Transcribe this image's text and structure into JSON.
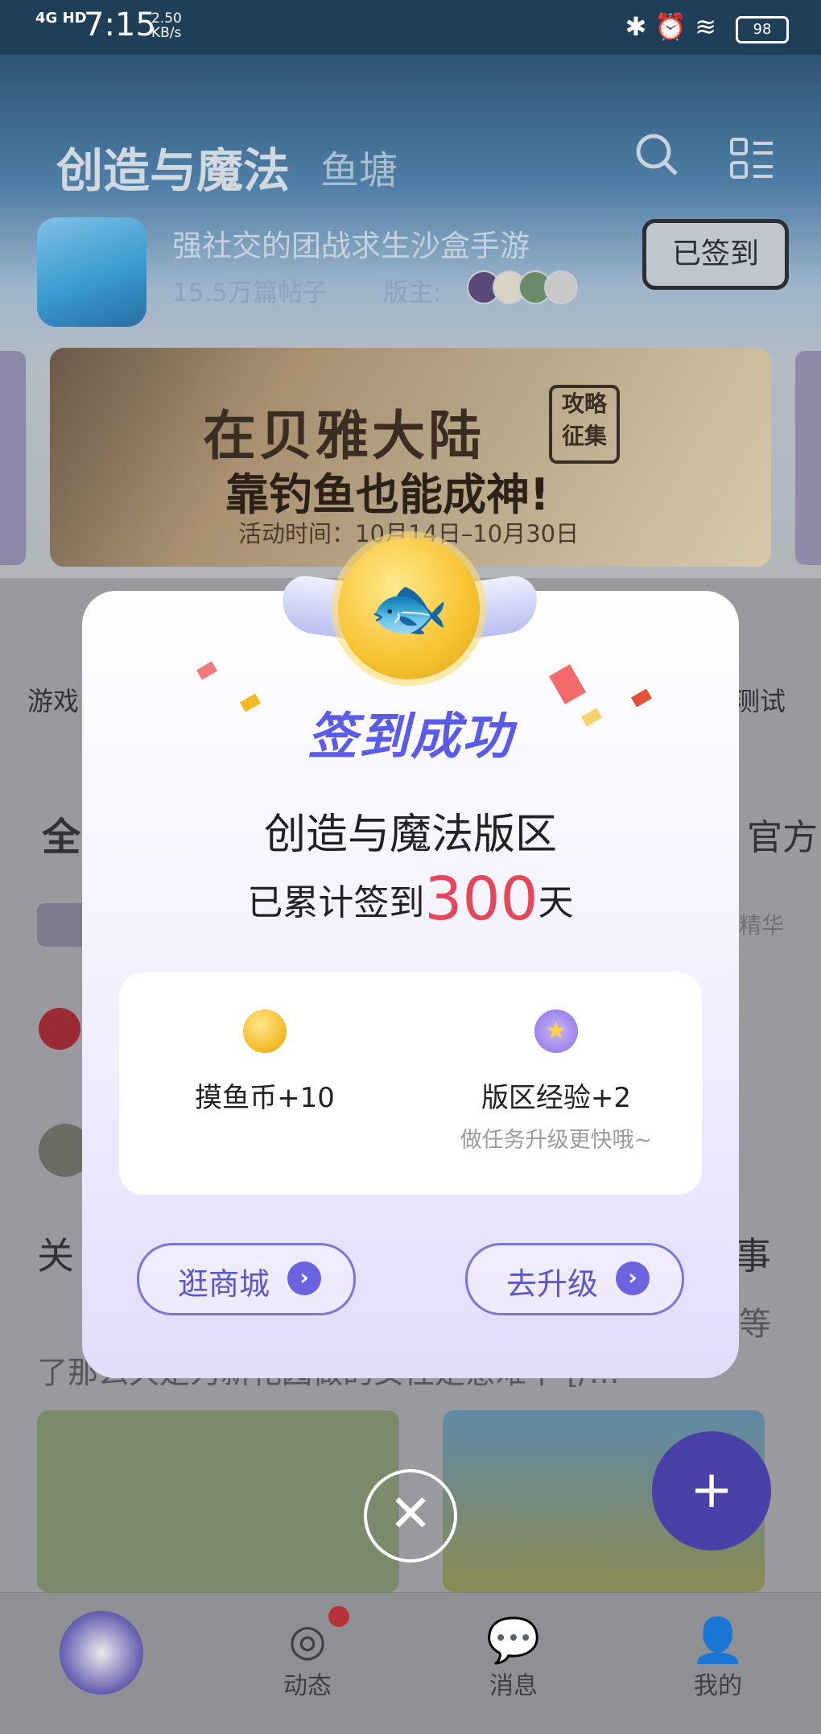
{
  "status_bar": {
    "network": "4G HD",
    "time": "7:15",
    "speed": "2.50",
    "speed_unit": "KB/s",
    "battery": "98"
  },
  "header": {
    "title": "创造与魔法",
    "tab2": "鱼塘",
    "search_icon": "search-icon",
    "menu_icon": "menu-grid-icon"
  },
  "community": {
    "slogan": "强社交的团战求生沙盒手游",
    "posts": "15.5万篇帖子",
    "moderator_label": "版主:",
    "signed_label": "已签到"
  },
  "banner": {
    "line1": "在贝雅大陆",
    "line2": "靠钓鱼也能成神!",
    "tag": "攻略征集",
    "date": "活动时间：10月14日–10月30日"
  },
  "background": {
    "shortcut_left": "游戏",
    "shortcut_right": "测试",
    "feed_tab": "全",
    "feed_tab_right": "官方",
    "chip_right": "精华",
    "post_title_left": "关",
    "post_title_right": "事",
    "snippet": "了那么久是为新花园做的女性是意难平 [/…",
    "snippet2": "等"
  },
  "modal": {
    "success": "签到成功",
    "zone": "创造与魔法版区",
    "days_prefix": "已累计签到",
    "days": "300",
    "days_suffix": "天",
    "reward1": "摸鱼币+10",
    "reward2": "版区经验+2",
    "reward2_hint": "做任务升级更快哦~",
    "btn_shop": "逛商城",
    "btn_upgrade": "去升级"
  },
  "bottom_nav": [
    {
      "label": "",
      "icon": "home-fish-icon"
    },
    {
      "label": "动态",
      "icon": "compass-icon"
    },
    {
      "label": "消息",
      "icon": "chat-icon"
    },
    {
      "label": "我的",
      "icon": "profile-icon"
    }
  ],
  "colors": {
    "accent": "#5a5ce8",
    "days": "#e5465a",
    "coin": "#f4b824"
  }
}
